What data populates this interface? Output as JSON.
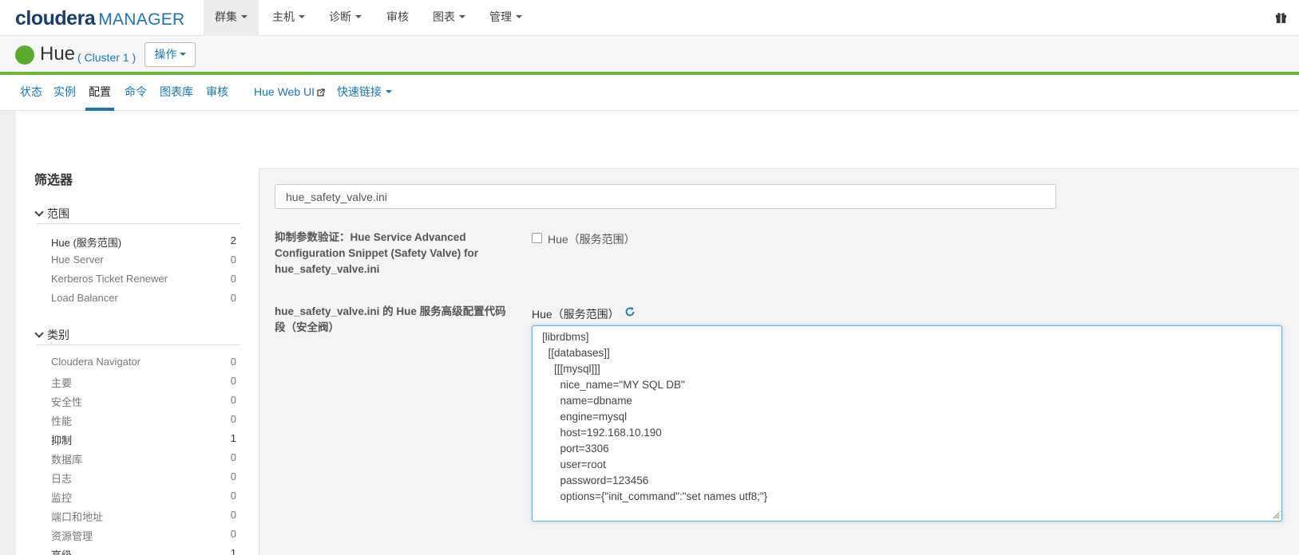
{
  "topnav": {
    "brand": "cloudera",
    "product": "MANAGER",
    "items": [
      {
        "label": "群集",
        "active": true,
        "caret": true
      },
      {
        "label": "主机",
        "active": false,
        "caret": true
      },
      {
        "label": "诊断",
        "active": false,
        "caret": true
      },
      {
        "label": "审核",
        "active": false,
        "caret": false
      },
      {
        "label": "图表",
        "active": false,
        "caret": true
      },
      {
        "label": "管理",
        "active": false,
        "caret": true
      }
    ],
    "right_icon": "gift-icon"
  },
  "service": {
    "name": "Hue",
    "cluster": "( Cluster 1 )",
    "status_color": "#5aac2e",
    "action_label": "操作"
  },
  "subtabs": [
    {
      "label": "状态"
    },
    {
      "label": "实例"
    },
    {
      "label": "配置",
      "active": true
    },
    {
      "label": "命令"
    },
    {
      "label": "图表库"
    },
    {
      "label": "审核"
    },
    {
      "label": "Hue Web UI"
    },
    {
      "label": "快速链接"
    }
  ],
  "filters": {
    "title": "筛选器",
    "scope": {
      "title": "范围",
      "items": [
        {
          "label": "Hue (服务范围)",
          "count": "2"
        },
        {
          "label": "Hue Server",
          "count": "0"
        },
        {
          "label": "Kerberos Ticket Renewer",
          "count": "0"
        },
        {
          "label": "Load Balancer",
          "count": "0"
        }
      ]
    },
    "category": {
      "title": "类别",
      "items": [
        {
          "label": "Cloudera Navigator",
          "count": "0"
        },
        {
          "label": "主要",
          "count": "0"
        },
        {
          "label": "安全性",
          "count": "0"
        },
        {
          "label": "性能",
          "count": "0"
        },
        {
          "label": "抑制",
          "count": "1"
        },
        {
          "label": "数据库",
          "count": "0"
        },
        {
          "label": "日志",
          "count": "0"
        },
        {
          "label": "监控",
          "count": "0"
        },
        {
          "label": "端口和地址",
          "count": "0"
        },
        {
          "label": "资源管理",
          "count": "0"
        },
        {
          "label": "高级",
          "count": "1"
        }
      ]
    }
  },
  "search": {
    "value": "hue_safety_valve.ini"
  },
  "properties": {
    "suppress": {
      "label_lines": [
        "抑制参数验证：Hue Service Advanced",
        "Configuration Snippet (Safety Valve) for",
        "hue_safety_valve.ini"
      ],
      "checkbox_label": "Hue（服务范围）"
    },
    "snippet": {
      "label_lines": [
        "hue_safety_valve.ini 的 Hue 服务高级配置代码",
        "段（安全阀）"
      ],
      "scope": "Hue（服务范围）",
      "code": [
        "[librdbms]",
        "  [[databases]]",
        "    [[[mysql]]]",
        "      nice_name=\"MY SQL DB\"",
        "      name=dbname",
        "      engine=mysql",
        "      host=192.168.10.190",
        "      port=3306",
        "      user=root",
        "      password=123456",
        "      options={\"init_command\":\"set names utf8;\"}"
      ]
    }
  }
}
